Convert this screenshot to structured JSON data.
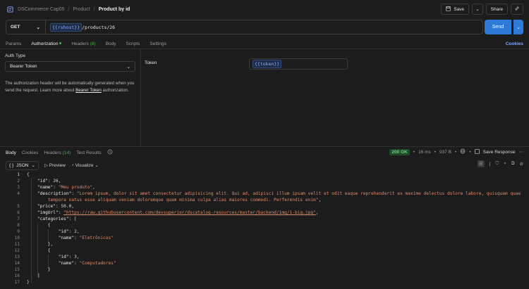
{
  "breadcrumb": {
    "collection": "DSCommerce Cap05",
    "folder": "Product",
    "request": "Product by id"
  },
  "top_actions": {
    "save_label": "Save",
    "share_label": "Share"
  },
  "request": {
    "method": "GET",
    "url_var": "{{rshost}}",
    "url_path": "/products/26",
    "send_label": "Send"
  },
  "req_tabs": {
    "params": "Params",
    "authorization": "Authorization",
    "headers": "Headers",
    "headers_count": "(8)",
    "body": "Body",
    "scripts": "Scripts",
    "settings": "Settings",
    "cookies": "Cookies"
  },
  "auth": {
    "type_label": "Auth Type",
    "type_value": "Bearer Token",
    "desc_part1": "The authorization header will be automatically generated when you send the request. Learn more about ",
    "desc_link": "Bearer Token",
    "desc_part2": " authorization.",
    "token_label": "Token",
    "token_value": "{{token}}"
  },
  "response": {
    "tabs": {
      "body": "Body",
      "cookies": "Cookies",
      "headers": "Headers",
      "headers_count": "(14)",
      "test_results": "Test Results"
    },
    "status": "200 OK",
    "time": "16 ms",
    "size": "937 B",
    "save_label": "Save Response",
    "format": "JSON",
    "preview": "Preview",
    "visualize": "Visualize"
  },
  "code_lines": [
    "1",
    "2",
    "3",
    "4",
    "",
    "5",
    "6",
    "7",
    "8",
    "9",
    "10",
    "11",
    "12",
    "13",
    "14",
    "15",
    "16",
    "17"
  ],
  "body_json": {
    "id": "26",
    "name": "\"Meu produto\"",
    "description_1": "\"Lorem ipsum, dolor sit amet consectetur adipisicing elit. Qui ad, adipisci illum ipsam velit et odit eaque reprehenderit ex maxime delectus dolore labore, quisquam quae",
    "description_2": "tempora natus esse aliquam veniam doloremque quam minima culpa alias maiores commodi. Perferendis enim\"",
    "price": "50.0",
    "imgUrl": "\"https://raw.githubusercontent.com/devsuperior/dscatalog-resources/master/backend/img/1-big.jpg\"",
    "cat1_id": "2",
    "cat1_name": "\"Eletrônicos\"",
    "cat2_id": "3",
    "cat2_name": "\"Computadores\""
  }
}
